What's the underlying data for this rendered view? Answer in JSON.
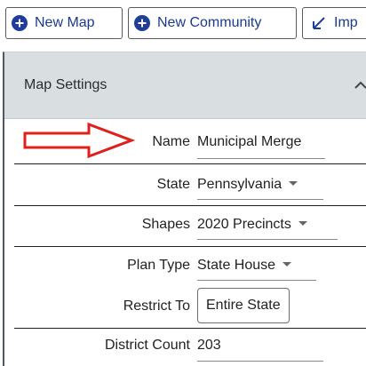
{
  "toolbar": {
    "new_map_label": "New Map",
    "new_community_label": "New Community",
    "import_label": "Imp",
    "accent_color": "#1f3d99"
  },
  "panel": {
    "title": "Map Settings",
    "collapse_icon": "chevron-up-icon",
    "header_bg": "#d9dfe1"
  },
  "fields": {
    "name": {
      "label": "Name",
      "value": "Municipal Merge"
    },
    "state": {
      "label": "State",
      "value": "Pennsylvania"
    },
    "shapes": {
      "label": "Shapes",
      "value": "2020 Precincts"
    },
    "plan_type": {
      "label": "Plan Type",
      "value": "State House"
    },
    "restrict_to": {
      "label": "Restrict To",
      "value": "Entire State"
    },
    "district_count": {
      "label": "District Count",
      "value": "203"
    }
  },
  "annotation": {
    "arrow_icon": "red-outline-arrow-icon",
    "arrow_color": "#e0201b"
  }
}
